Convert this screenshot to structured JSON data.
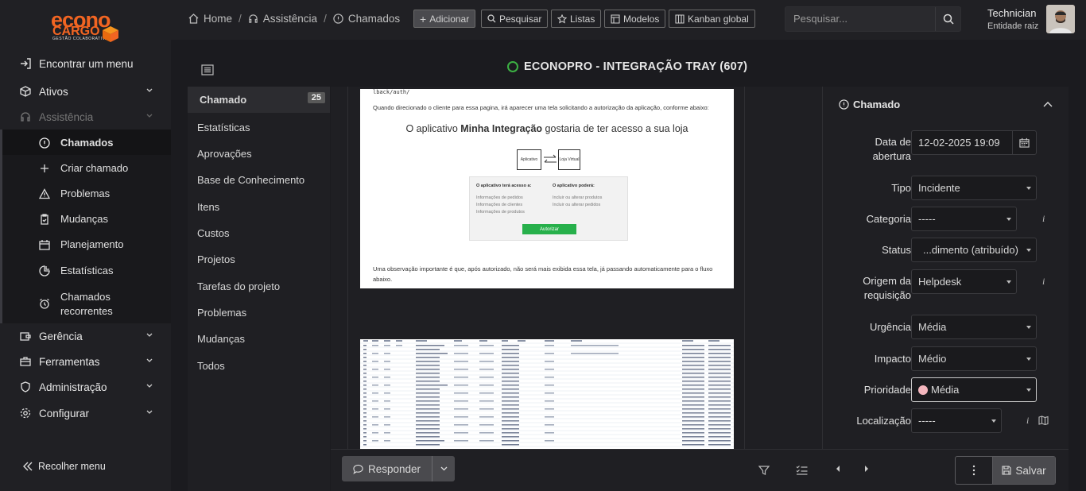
{
  "brand": {
    "line1": "econo",
    "line2": "CARGO",
    "tagline": "GESTÃO COLABORATIVA"
  },
  "sidebar": {
    "items": [
      {
        "label": "Encontrar um menu"
      },
      {
        "label": "Ativos"
      },
      {
        "label": "Assistência"
      },
      {
        "label": "Gerência"
      },
      {
        "label": "Ferramentas"
      },
      {
        "label": "Administração"
      },
      {
        "label": "Configurar"
      }
    ],
    "sub_items": [
      {
        "label": "Chamados"
      },
      {
        "label": "Criar chamado"
      },
      {
        "label": "Problemas"
      },
      {
        "label": "Mudanças"
      },
      {
        "label": "Planejamento"
      },
      {
        "label": "Estatísticas"
      },
      {
        "label": "Chamados recorrentes"
      }
    ],
    "collapse_label": "Recolher menu"
  },
  "breadcrumb": {
    "home": "Home",
    "section": "Assistência",
    "page": "Chamados"
  },
  "toolbar": {
    "add": "Adicionar",
    "search": "Pesquisar",
    "lists": "Listas",
    "templates": "Modelos",
    "kanban": "Kanban global"
  },
  "global_search": {
    "placeholder": "Pesquisar..."
  },
  "user": {
    "name": "Technician",
    "entity": "Entidade raiz"
  },
  "ticket": {
    "title": "ECONOPRO - INTEGRAÇÃO TRAY (607)",
    "status_color": "#3cb043"
  },
  "tabs": [
    {
      "label": "Chamado",
      "badge": "25"
    },
    {
      "label": "Estatísticas"
    },
    {
      "label": "Aprovações"
    },
    {
      "label": "Base de Conhecimento"
    },
    {
      "label": "Itens"
    },
    {
      "label": "Custos"
    },
    {
      "label": "Projetos"
    },
    {
      "label": "Tarefas do projeto"
    },
    {
      "label": "Problemas"
    },
    {
      "label": "Mudanças"
    },
    {
      "label": "Todos"
    }
  ],
  "document": {
    "url_fragment": "lback/auth/",
    "intro": "Quando direcionado o cliente para essa pagina, irá aparecer uma tela solicitando a autorização da aplicação, conforme abaixo:",
    "heading_pre": "O aplicativo ",
    "heading_bold": "Minha Integração",
    "heading_post": " gostaria de ter acesso a sua loja",
    "box_app": "Aplicativo",
    "box_store": "Loja Virtual",
    "col1_title": "O aplicativo terá acesso a:",
    "col1_items": [
      "Informações de pedidos",
      "Informações de clientes",
      "Informações de produtos"
    ],
    "col2_title": "O aplicativo poderá:",
    "col2_items": [
      "Incluir ou alterar produtos",
      "Incluir ou alterar pedidos"
    ],
    "authorize": "Autorizar",
    "note": "Uma observação importante é que, após autorizado, não será mais exibida essa tela, já passando automaticamente para o fluxo abaixo."
  },
  "panel": {
    "header": "Chamado",
    "fields": [
      {
        "label": "Data de abertura",
        "value": "12-02-2025 19:09"
      },
      {
        "label": "Tipo",
        "value": "Incidente"
      },
      {
        "label": "Categoria",
        "value": "-----"
      },
      {
        "label": "Status",
        "value": "...dimento (atribuído)"
      },
      {
        "label": "Origem da requisição",
        "value": "Helpdesk"
      },
      {
        "label": "Urgência",
        "value": "Média"
      },
      {
        "label": "Impacto",
        "value": "Médio"
      },
      {
        "label": "Prioridade",
        "value": "Média"
      },
      {
        "label": "Localização",
        "value": "-----"
      }
    ],
    "priority_color": "#f4b6bd"
  },
  "actions": {
    "reply": "Responder",
    "save": "Salvar"
  }
}
